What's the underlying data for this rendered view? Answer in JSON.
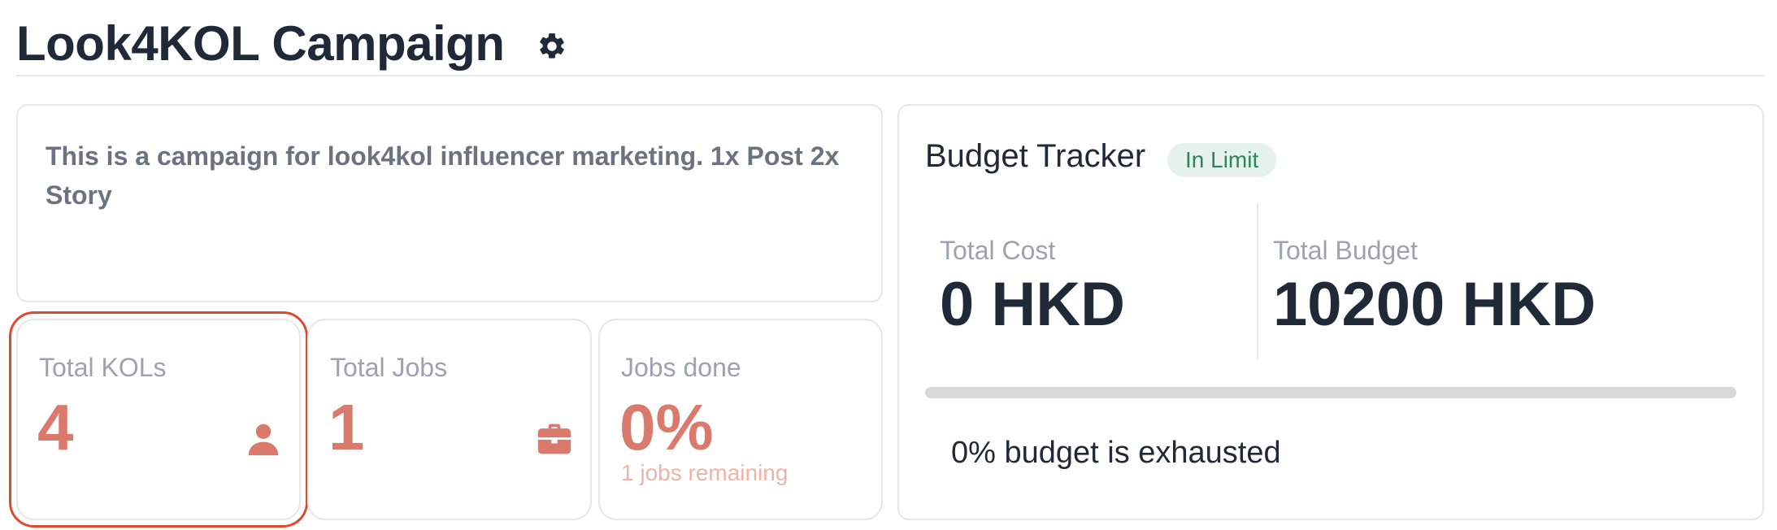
{
  "header": {
    "title": "Look4KOL Campaign",
    "settings_icon": "gear-icon"
  },
  "description": "This is a campaign for look4kol influencer marketing. 1x Post 2x Story",
  "stats": {
    "total_kols": {
      "label": "Total KOLs",
      "value": "4",
      "icon": "person-icon"
    },
    "total_jobs": {
      "label": "Total Jobs",
      "value": "1",
      "icon": "briefcase-icon"
    },
    "jobs_done": {
      "label": "Jobs done",
      "value": "0%",
      "sub": "1 jobs remaining"
    }
  },
  "budget": {
    "title": "Budget Tracker",
    "status_badge": "In Limit",
    "total_cost_label": "Total Cost",
    "total_cost_value": "0 HKD",
    "total_budget_label": "Total Budget",
    "total_budget_value": "10200 HKD",
    "progress_fraction": 0,
    "exhausted_text": "0% budget is exhausted"
  },
  "colors": {
    "accent": "#d97a6c",
    "accent_light": "#f0b3a6",
    "badge_bg": "#e6f3ec",
    "badge_text": "#2f855a",
    "focus_outline": "#dc4b2f"
  }
}
